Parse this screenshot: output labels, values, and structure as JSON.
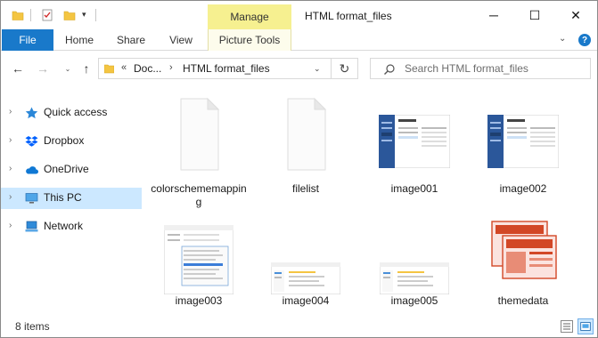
{
  "titlebar": {
    "manage_label": "Manage",
    "title": "HTML format_files",
    "minimize_glyph": "─",
    "maximize_glyph": "☐",
    "close_glyph": "✕",
    "qat_arrow_glyph": "▾"
  },
  "ribbon": {
    "tabs": [
      "File",
      "Home",
      "Share",
      "View",
      "Picture Tools"
    ],
    "expand_glyph": "⌄",
    "help_glyph": "?"
  },
  "address_bar": {
    "back_glyph": "←",
    "forward_glyph": "→",
    "recent_glyph": "⌄",
    "up_glyph": "↑",
    "chevrons_glyph": "«",
    "crumbs": [
      "Doc...",
      "HTML format_files"
    ],
    "separator_glyph": "›",
    "dropdown_glyph": "⌄",
    "refresh_glyph": "↻"
  },
  "search": {
    "placeholder": "Search HTML format_files"
  },
  "sidebar": {
    "chevron_glyph": "›",
    "items": [
      {
        "label": "Quick access",
        "icon": "star-icon"
      },
      {
        "label": "Dropbox",
        "icon": "dropbox-icon"
      },
      {
        "label": "OneDrive",
        "icon": "cloud-icon"
      },
      {
        "label": "This PC",
        "icon": "computer-icon",
        "selected": true
      },
      {
        "label": "Network",
        "icon": "network-icon"
      }
    ]
  },
  "files": [
    {
      "name": "colorschememapping",
      "kind": "document"
    },
    {
      "name": "filelist",
      "kind": "document"
    },
    {
      "name": "image001",
      "kind": "screenshot-save-as"
    },
    {
      "name": "image002",
      "kind": "screenshot-save-as"
    },
    {
      "name": "image003",
      "kind": "screenshot-dialog"
    },
    {
      "name": "image004",
      "kind": "screenshot-wide"
    },
    {
      "name": "image005",
      "kind": "screenshot-wide"
    },
    {
      "name": "themedata",
      "kind": "theme"
    }
  ],
  "status": {
    "item_count": "8 items"
  },
  "colors": {
    "accent": "#1979ca",
    "manage_tab": "#f6f090",
    "selection": "#cce8ff"
  }
}
